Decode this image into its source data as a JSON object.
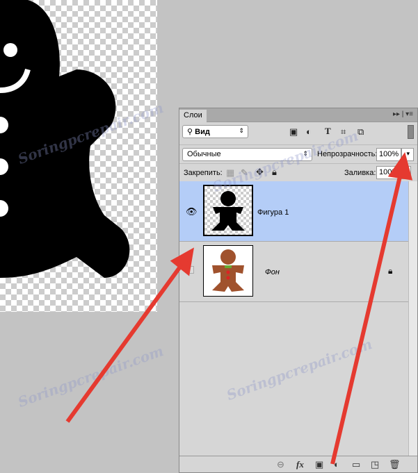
{
  "watermark": "Soringpcrepair.com",
  "panel": {
    "tab": "Слои",
    "filter": {
      "label": "Вид"
    },
    "blend_mode": "Обычные",
    "opacity_label": "Непрозрачность:",
    "opacity_value": "100%",
    "lock_label": "Закрепить:",
    "fill_label": "Заливка:",
    "fill_value": "100%",
    "layers": [
      {
        "name": "Фигура 1",
        "visible": true,
        "selected": true
      },
      {
        "name": "Фон",
        "visible": false,
        "locked": true
      }
    ],
    "footer_icons": [
      "link-icon",
      "fx-icon",
      "mask-icon",
      "adjustment-icon",
      "folder-icon",
      "new-layer-icon",
      "trash-icon"
    ]
  },
  "colors": {
    "selection": "#b4cdf7",
    "arrow": "#e53a30"
  }
}
